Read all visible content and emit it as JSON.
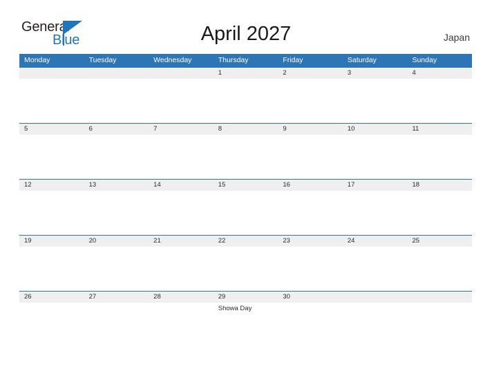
{
  "header": {
    "logo": {
      "primary_text": "General",
      "secondary_text": "Blue",
      "primary_color": "#231f20",
      "secondary_color": "#1f76bc",
      "flag_color": "#1f76bc"
    },
    "title": "April 2027",
    "country": "Japan"
  },
  "theme": {
    "header_blue": "#2e75b6",
    "band_gray": "#efefef",
    "text_dark": "#2b2b2b",
    "page_background": "#ffffff"
  },
  "calendar": {
    "weekdays": [
      "Monday",
      "Tuesday",
      "Wednesday",
      "Thursday",
      "Friday",
      "Saturday",
      "Sunday"
    ],
    "weeks": [
      {
        "days": [
          "",
          "",
          "",
          "1",
          "2",
          "3",
          "4"
        ],
        "events": [
          "",
          "",
          "",
          "",
          "",
          "",
          ""
        ]
      },
      {
        "days": [
          "5",
          "6",
          "7",
          "8",
          "9",
          "10",
          "11"
        ],
        "events": [
          "",
          "",
          "",
          "",
          "",
          "",
          ""
        ]
      },
      {
        "days": [
          "12",
          "13",
          "14",
          "15",
          "16",
          "17",
          "18"
        ],
        "events": [
          "",
          "",
          "",
          "",
          "",
          "",
          ""
        ]
      },
      {
        "days": [
          "19",
          "20",
          "21",
          "22",
          "23",
          "24",
          "25"
        ],
        "events": [
          "",
          "",
          "",
          "",
          "",
          "",
          ""
        ]
      },
      {
        "days": [
          "26",
          "27",
          "28",
          "29",
          "30",
          "",
          ""
        ],
        "events": [
          "",
          "",
          "",
          "Showa Day",
          "",
          "",
          ""
        ]
      }
    ]
  }
}
